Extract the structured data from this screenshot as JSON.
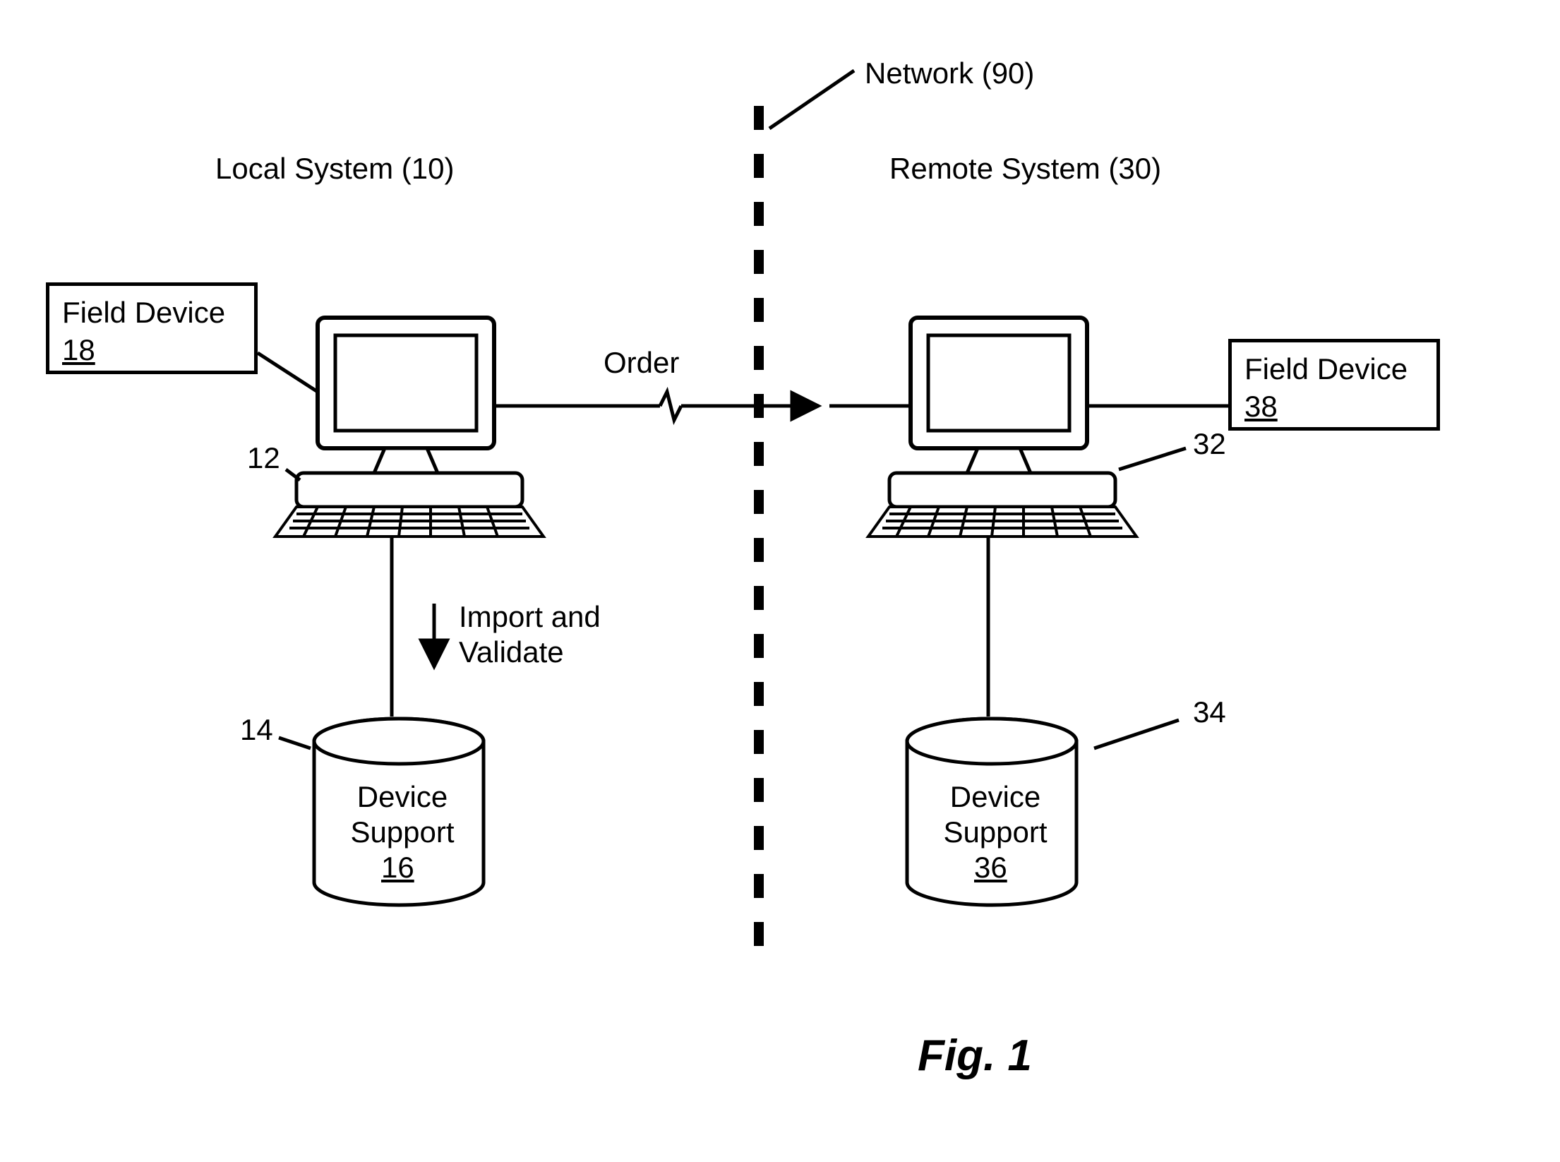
{
  "labels": {
    "network": "Network (90)",
    "local_system": "Local System (10)",
    "remote_system": "Remote System (30)",
    "order": "Order",
    "import_validate_l1": "Import and",
    "import_validate_l2": "Validate",
    "figure": "Fig. 1"
  },
  "field_device_left": {
    "title": "Field Device",
    "ref": "18"
  },
  "field_device_right": {
    "title": "Field Device",
    "ref": "38"
  },
  "db_left": {
    "l1": "Device",
    "l2": "Support",
    "ref": "16"
  },
  "db_right": {
    "l1": "Device",
    "l2": "Support",
    "ref": "36"
  },
  "refs": {
    "pc_left": "12",
    "pc_right": "32",
    "db_left": "14",
    "db_right": "34"
  }
}
